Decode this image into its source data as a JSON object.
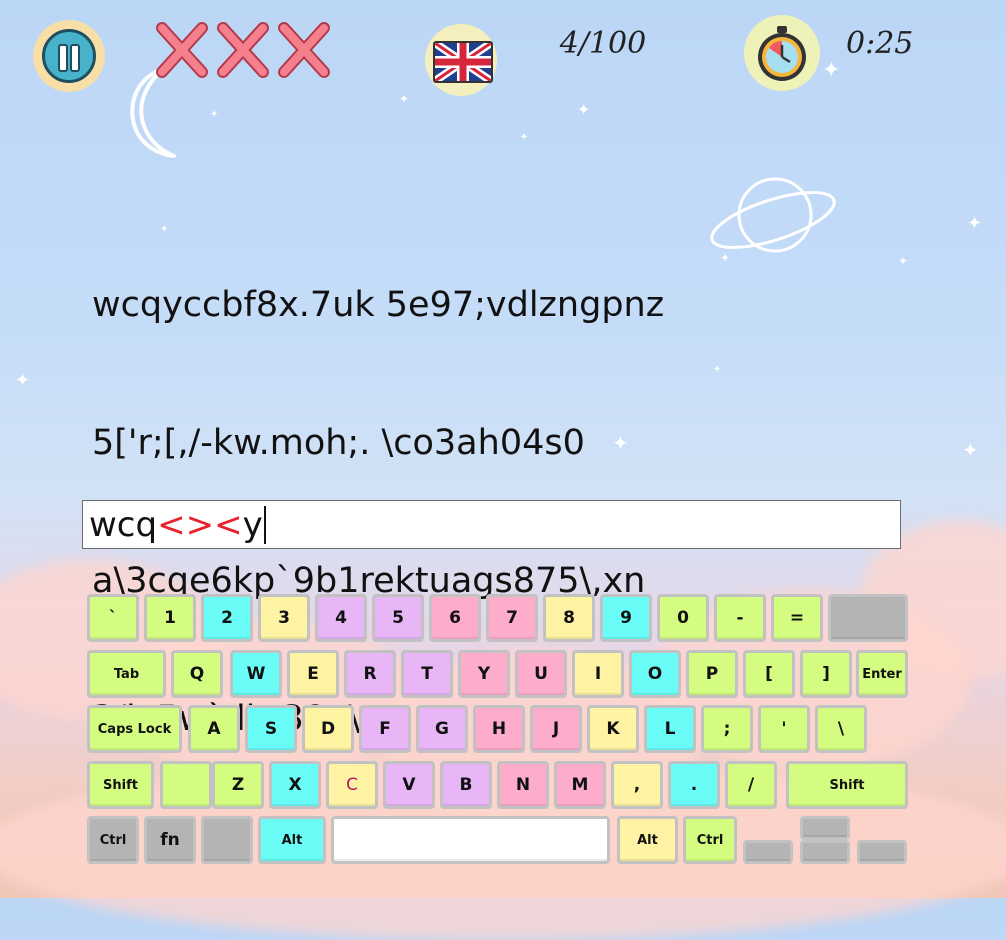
{
  "hud": {
    "pause_icon": "pause-icon",
    "lives_icon": "cross-icon",
    "lives_count": 3,
    "language_icon": "uk-flag-icon",
    "progress_text": "4/100",
    "timer_icon": "stopwatch-icon",
    "timer_text": "0:25"
  },
  "target_text": {
    "lines": [
      "wcqyccbf8x.7uk 5e97;vdlzngpnz",
      "5['r;[,/-kw.moh;. \\co3ah04s0",
      "a\\3cqe6kp`9b1rektuags875\\,xn",
      "3/jv5w`,lbt38q\\"
    ]
  },
  "input": {
    "typed_correct": "wcq",
    "typed_wrong": "<><",
    "typed_rest": "y"
  },
  "keyboard": {
    "colors": {
      "green": "#d3fc80",
      "cyan": "#6afcf7",
      "yellow": "#fdf3a3",
      "purple": "#e8b6f7",
      "pink": "#fdaccb",
      "gray": "#b4b4b4",
      "hint_text": "#b5175b"
    },
    "rows": [
      [
        {
          "label": "`"
        },
        {
          "label": "1"
        },
        {
          "label": "2"
        },
        {
          "label": "3"
        },
        {
          "label": "4"
        },
        {
          "label": "5"
        },
        {
          "label": "6"
        },
        {
          "label": "7"
        },
        {
          "label": "8"
        },
        {
          "label": "9"
        },
        {
          "label": "0"
        },
        {
          "label": "-"
        },
        {
          "label": "="
        },
        {
          "label": ""
        }
      ],
      [
        {
          "label": "Tab"
        },
        {
          "label": "Q"
        },
        {
          "label": "W"
        },
        {
          "label": "E"
        },
        {
          "label": "R"
        },
        {
          "label": "T"
        },
        {
          "label": "Y"
        },
        {
          "label": "U"
        },
        {
          "label": "I"
        },
        {
          "label": "O"
        },
        {
          "label": "P"
        },
        {
          "label": "["
        },
        {
          "label": "]"
        },
        {
          "label": "Enter"
        }
      ],
      [
        {
          "label": "Caps Lock"
        },
        {
          "label": "A"
        },
        {
          "label": "S"
        },
        {
          "label": "D"
        },
        {
          "label": "F"
        },
        {
          "label": "G"
        },
        {
          "label": "H"
        },
        {
          "label": "J"
        },
        {
          "label": "K"
        },
        {
          "label": "L"
        },
        {
          "label": ";"
        },
        {
          "label": "'"
        },
        {
          "label": "\\"
        }
      ],
      [
        {
          "label": "Shift"
        },
        {
          "label": ""
        },
        {
          "label": "Z"
        },
        {
          "label": "X"
        },
        {
          "label": "C",
          "hint": true
        },
        {
          "label": "V"
        },
        {
          "label": "B"
        },
        {
          "label": "N"
        },
        {
          "label": "M"
        },
        {
          "label": ","
        },
        {
          "label": "."
        },
        {
          "label": "/"
        },
        {
          "label": "Shift"
        }
      ],
      [
        {
          "label": "Ctrl"
        },
        {
          "label": "fn"
        },
        {
          "label": ""
        },
        {
          "label": "Alt"
        },
        {
          "label": ""
        },
        {
          "label": "Alt"
        },
        {
          "label": "Ctrl"
        },
        {
          "label": ""
        },
        {
          "label": ""
        },
        {
          "label": ""
        },
        {
          "label": ""
        }
      ]
    ]
  }
}
